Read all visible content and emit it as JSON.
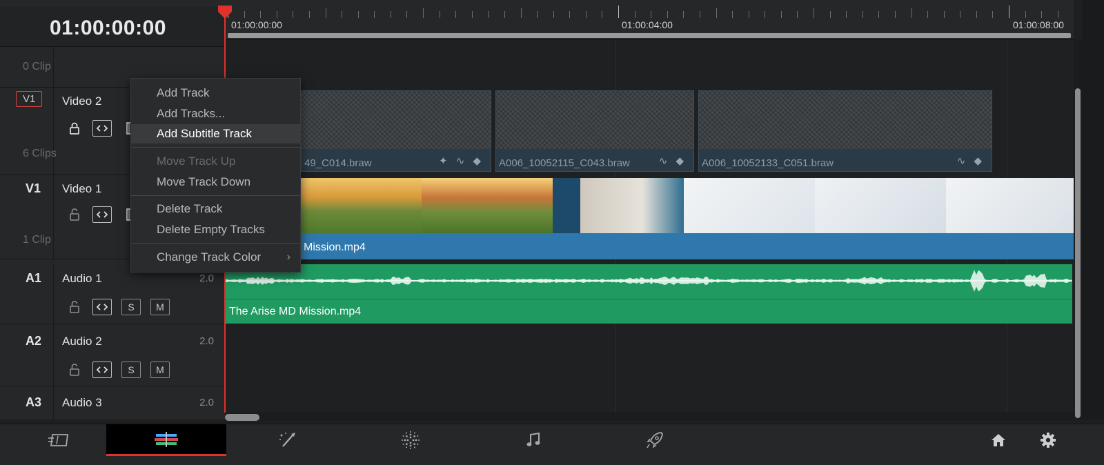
{
  "header": {
    "timecode": "01:00:00:00"
  },
  "ruler": {
    "labels": [
      "01:00:00:00",
      "01:00:04:00",
      "01:00:08:00"
    ]
  },
  "tracks": {
    "above": {
      "clip_count": "0 Clip"
    },
    "v2": {
      "id": "V1",
      "name": "Video 2",
      "clip_count": "6 Clips"
    },
    "v1": {
      "id": "V1",
      "name": "Video 1",
      "clip_count": "1 Clip"
    },
    "a1": {
      "id": "A1",
      "name": "Audio 1",
      "channels": "2.0",
      "solo": "S",
      "mute": "M"
    },
    "a2": {
      "id": "A2",
      "name": "Audio 2",
      "channels": "2.0",
      "solo": "S",
      "mute": "M"
    },
    "a3": {
      "id": "A3",
      "name": "Audio 3",
      "channels": "2.0"
    }
  },
  "clips": {
    "v2": [
      {
        "name": "49_C014.braw"
      },
      {
        "name": "A006_10052115_C043.braw"
      },
      {
        "name": "A006_10052133_C051.braw"
      }
    ],
    "v1": {
      "name": "Mission.mp4"
    },
    "a1": {
      "name": "The Arise MD Mission.mp4"
    }
  },
  "context_menu": {
    "items": [
      {
        "label": "Add Track",
        "state": "normal"
      },
      {
        "label": "Add Tracks...",
        "state": "normal"
      },
      {
        "label": "Add Subtitle Track",
        "state": "highlighted"
      },
      {
        "label": "Move Track Up",
        "state": "disabled"
      },
      {
        "label": "Move Track Down",
        "state": "normal"
      },
      {
        "label": "Delete Track",
        "state": "normal"
      },
      {
        "label": "Delete Empty Tracks",
        "state": "normal"
      },
      {
        "label": "Change Track Color",
        "state": "normal",
        "submenu_icon": "chevron-right-icon"
      }
    ]
  },
  "bottom_bar": {
    "pages": [
      {
        "icon": "media-page-icon"
      },
      {
        "icon": "edit-page-icon",
        "active": true
      },
      {
        "icon": "fusion-page-icon"
      },
      {
        "icon": "color-page-icon"
      },
      {
        "icon": "fairlight-page-icon"
      },
      {
        "icon": "deliver-page-icon"
      }
    ],
    "right_icons": [
      "home-icon",
      "settings-icon"
    ]
  },
  "colors": {
    "playhead": "#e0322b",
    "video_clip": "#2f78ad",
    "audio_clip": "#1f9a61",
    "menu_bg": "#2a2b2d"
  }
}
